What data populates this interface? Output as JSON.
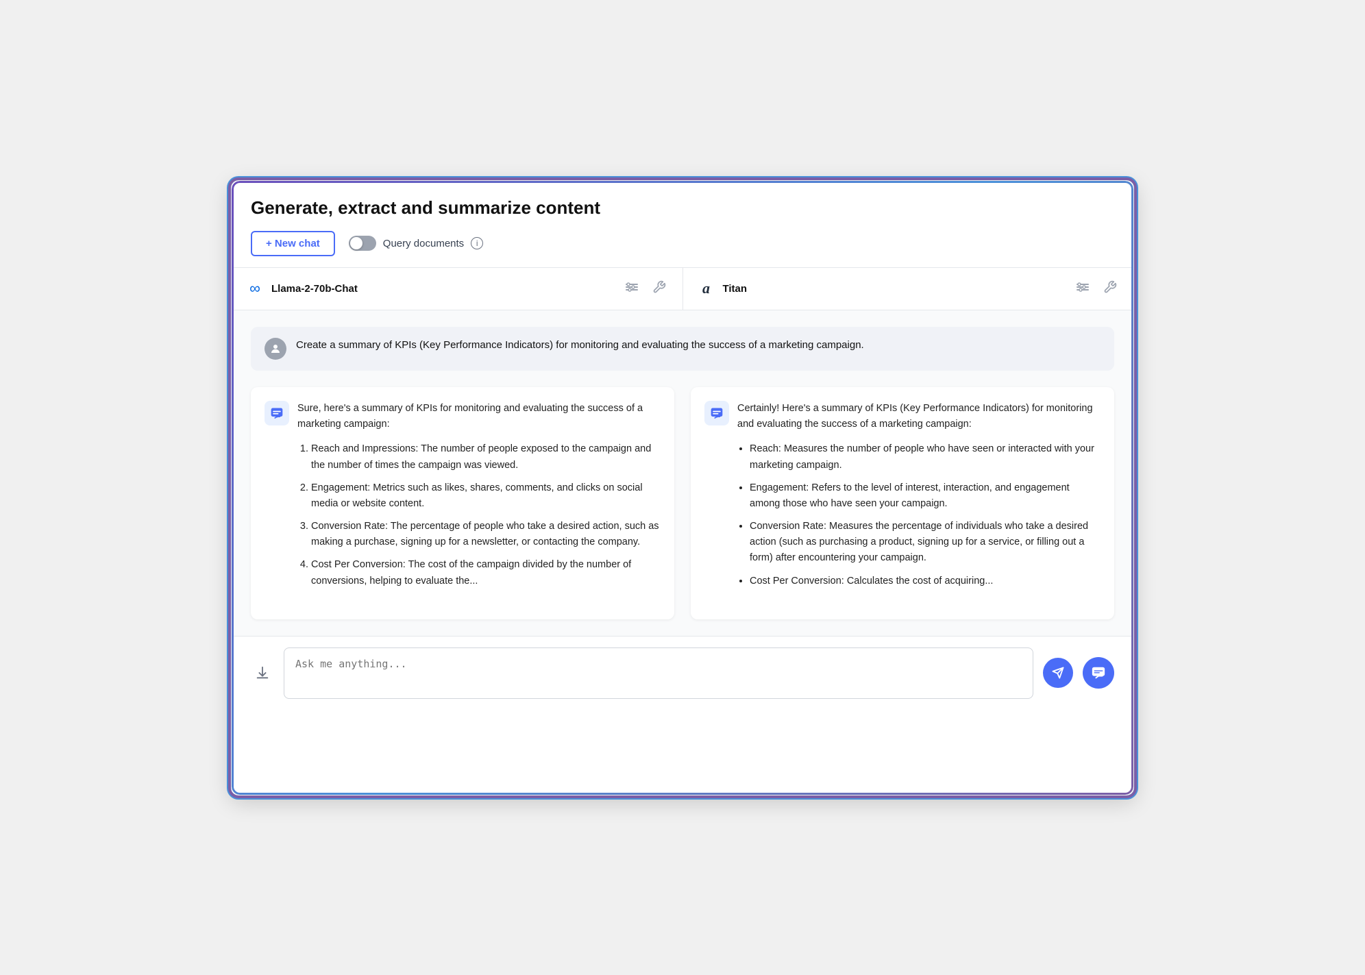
{
  "header": {
    "title": "Generate, extract and summarize content",
    "new_chat_label": "+ New chat",
    "query_docs_label": "Query documents",
    "info_symbol": "i"
  },
  "models": [
    {
      "id": "llama",
      "logo_symbol": "∞",
      "name": "Llama-2-70b-Chat",
      "settings_icon": "⊞",
      "tools_icon": "🔧"
    },
    {
      "id": "titan",
      "logo_symbol": "a",
      "name": "Titan",
      "settings_icon": "⊞",
      "tools_icon": "🔧"
    }
  ],
  "user_message": {
    "text": "Create a summary of KPIs (Key Performance Indicators) for monitoring and evaluating the success of a marketing campaign."
  },
  "responses": [
    {
      "id": "llama",
      "intro": "Sure, here's a summary of KPIs for monitoring and evaluating the success of a marketing campaign:",
      "list_type": "ordered",
      "items": [
        "Reach and Impressions: The number of people exposed to the campaign and the number of times the campaign was viewed.",
        "Engagement: Metrics such as likes, shares, comments, and clicks on social media or website content.",
        "Conversion Rate: The percentage of people who take a desired action, such as making a purchase, signing up for a newsletter, or contacting the company.",
        "Cost Per Conversion: The cost of the campaign divided by the number of conversions, helping to evaluate the..."
      ]
    },
    {
      "id": "titan",
      "intro": "Certainly! Here's a summary of KPIs (Key Performance Indicators) for monitoring and evaluating the success of a marketing campaign:",
      "list_type": "bullet",
      "items": [
        "Reach: Measures the number of people who have seen or interacted with your marketing campaign.",
        "Engagement: Refers to the level of interest, interaction, and engagement among those who have seen your campaign.",
        "Conversion Rate: Measures the percentage of individuals who take a desired action (such as purchasing a product, signing up for a service, or filling out a form) after encountering your campaign.",
        "Cost Per Conversion: Calculates the cost of acquiring..."
      ]
    }
  ],
  "input": {
    "placeholder": "Ask me anything..."
  },
  "icons": {
    "user": "👤",
    "ai": "💬",
    "download": "⬇",
    "send": "➤",
    "chat_fab": "💬"
  }
}
